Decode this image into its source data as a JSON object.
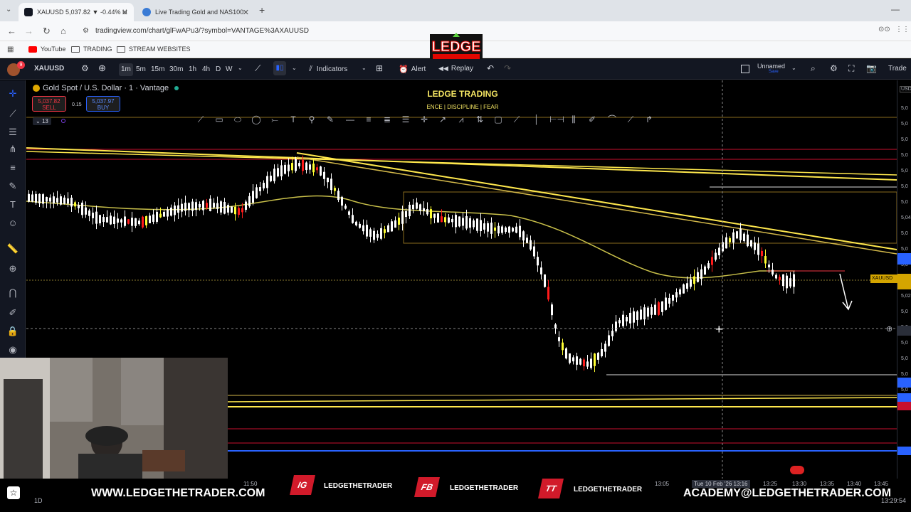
{
  "browser": {
    "tabs": [
      {
        "label": "XAUUSD 5,037.82 ▼ -0.44% U",
        "active": true
      },
      {
        "label": "Live Trading Gold and NAS100",
        "active": false
      }
    ],
    "new_tab": "+",
    "url": "tradingview.com/chart/glFwAPu3/?symbol=VANTAGE%3AXAUUSD",
    "bookmarks": [
      "YouTube",
      "TRADING",
      "STREAM WEBSITES"
    ]
  },
  "logo": {
    "text": "LEDGE"
  },
  "toolbar": {
    "symbol": "XAUUSD",
    "timeframes": [
      "1m",
      "5m",
      "15m",
      "30m",
      "1h",
      "4h",
      "D",
      "W"
    ],
    "selected_timeframe": "1m",
    "indicators_label": "Indicators",
    "alert_label": "Alert",
    "replay_label": "Replay",
    "layout_name": "Unnamed",
    "layout_sub": "Save",
    "trade_label": "Trade",
    "avatar_badge": "9"
  },
  "legend": {
    "title": "Gold Spot / U.S. Dollar · 1 · Vantage",
    "sell_price": "5,037.82",
    "sell_label": "SELL",
    "spread": "0.15",
    "buy_price": "5,037.97",
    "buy_label": "BUY",
    "indicator_count": "13"
  },
  "overlay": {
    "title": "LEDGE TRADING",
    "subtitle": "ENCE | DISCIPLINE | FEAR"
  },
  "price_scale": {
    "currency": "USD",
    "labels": [
      "5,0",
      "5,0",
      "5,0",
      "5,0",
      "5,0",
      "5,0",
      "5,0",
      "5,04",
      "5,0",
      "5,0",
      "5,0",
      "5,0",
      "5,02",
      "5,0",
      "5,0",
      "5,0",
      "5,0",
      "5,0",
      "5,0",
      "5,0"
    ],
    "current_tag": "XAUUSD"
  },
  "time_axis": {
    "labels": [
      "11:50",
      "13:05",
      "13:25",
      "13:30",
      "13:35",
      "13:40",
      "13:45"
    ],
    "crosshair_label": "Tue 10 Feb '26  13:16"
  },
  "bottom": {
    "website": "WWW.LEDGETHETRADER.COM",
    "socials": [
      {
        "badge": "IG",
        "handle": "LEDGETHETRADER"
      },
      {
        "badge": "FB",
        "handle": "LEDGETHETRADER"
      },
      {
        "badge": "TT",
        "handle": "LEDGETHETRADER"
      }
    ],
    "email": "ACADEMY@LEDGETHETRADER.COM",
    "clock": "13:29:54",
    "range_label": "1D"
  },
  "colors": {
    "bull_candle": "#ffffff",
    "bear_candle": "#ff1a1a",
    "highlight_candle": "#ffff33",
    "trendline": "#ffe84d",
    "ma_line": "#c9c04a",
    "level_red": "#c8102e",
    "level_blue": "#2962ff"
  }
}
